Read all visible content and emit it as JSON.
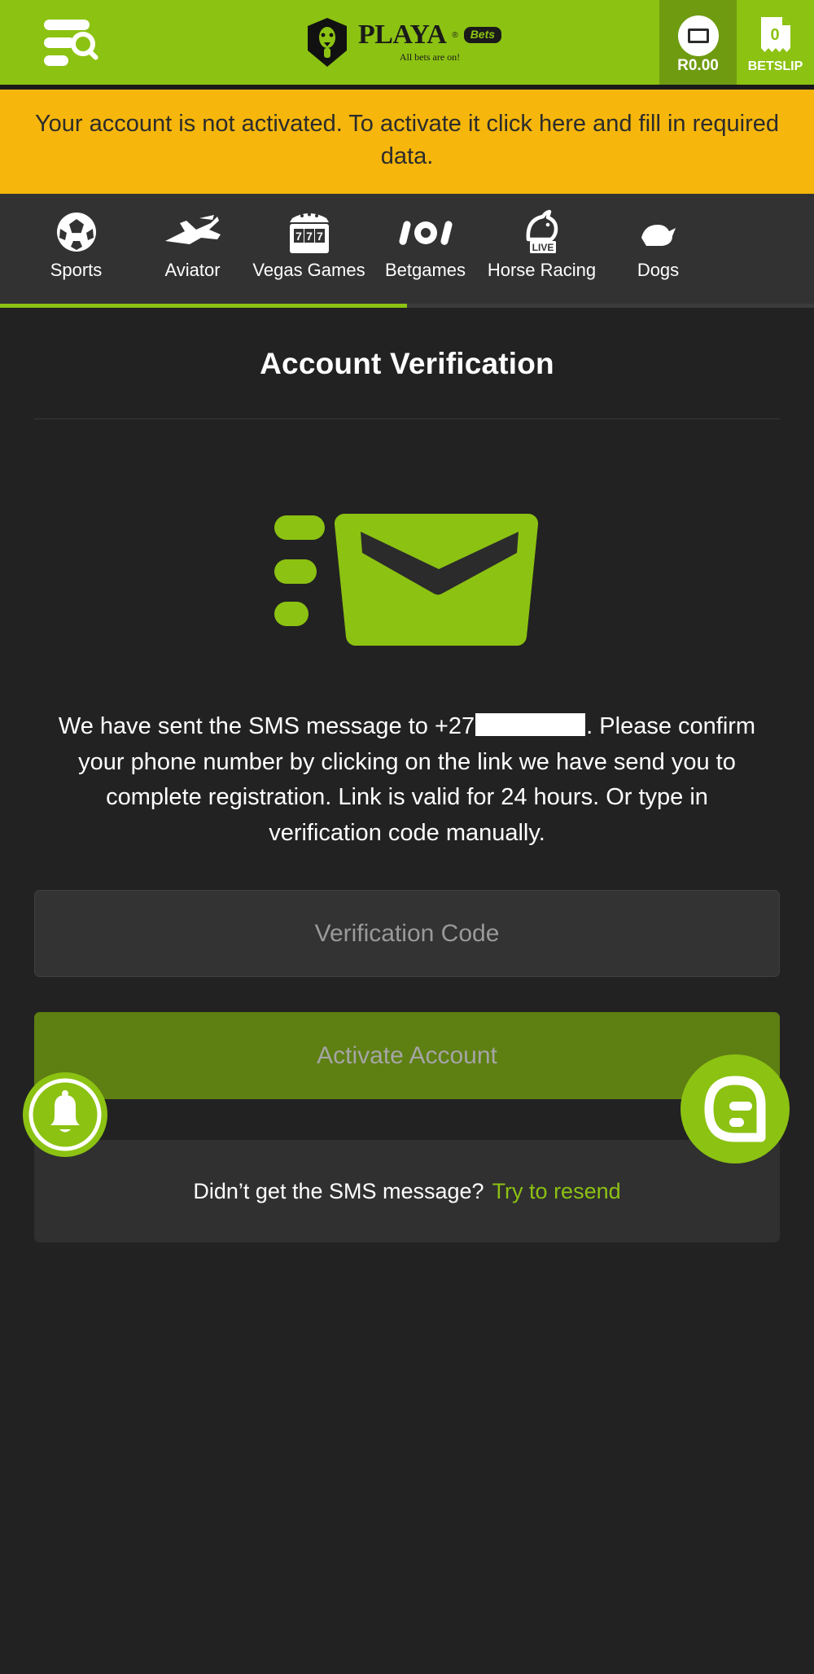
{
  "brand": {
    "accent_green": "#8CC212",
    "dark_green": "#6F9B10",
    "alert_yellow": "#F6B60B",
    "bg_dark": "#222222",
    "panel_dark": "#333333"
  },
  "header": {
    "menu_icon": "menu-search-icon",
    "logo_name": "PLAYA",
    "logo_registered": "®",
    "logo_badge": "Bets",
    "logo_tagline": "All bets are on!",
    "balance_amount": "R0.00",
    "balance_icon": "wallet-card-icon",
    "betslip_count": "0",
    "betslip_label": "BETSLIP",
    "betslip_icon": "receipt-icon"
  },
  "alert": {
    "text": "Your account is not activated. To activate it click here and fill in required data."
  },
  "nav": {
    "items": [
      {
        "label": "Sports",
        "icon": "soccer-ball-icon"
      },
      {
        "label": "Aviator",
        "icon": "airplane-icon"
      },
      {
        "label": "Vegas Games",
        "icon": "slot-machine-icon"
      },
      {
        "label": "Betgames",
        "icon": "betgames-dice-icon"
      },
      {
        "label": "Horse Racing",
        "icon": "horse-live-icon"
      },
      {
        "label": "Dogs",
        "icon": "dog-racing-icon"
      }
    ],
    "scroll_position_percent": 50
  },
  "main": {
    "title": "Account Verification",
    "illustration_icon": "send-mail-icon",
    "message_line_1": "We have sent the SMS message to +27",
    "message_redacted": "",
    "message_line_2": ". Please confirm your phone number by clicking on the link we have send you to complete registration. Link is valid for 24 hours. Or type in verification code manually.",
    "verification_input": {
      "placeholder": "Verification Code",
      "value": ""
    },
    "activate_button": "Activate Account",
    "resend_prompt": "Didn’t get the SMS message?",
    "resend_link": "Try to resend"
  },
  "floating": {
    "bell_icon": "bell-notification-icon",
    "chat_icon": "chat-support-icon"
  }
}
